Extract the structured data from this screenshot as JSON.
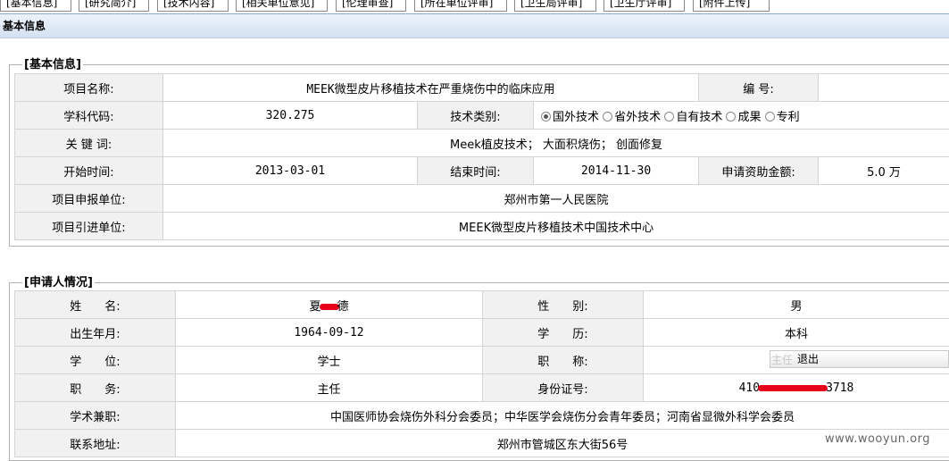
{
  "tabs": [
    {
      "label": "[基本信息]",
      "active": true
    },
    {
      "label": "[研究简介]"
    },
    {
      "label": "[技术内容]"
    },
    {
      "label": "[相关单位意见]"
    },
    {
      "label": "[伦理审查]"
    },
    {
      "label": "[所在单位评审]"
    },
    {
      "label": "[卫生局评审]"
    },
    {
      "label": "[卫生厅评审]"
    },
    {
      "label": "[附件上传]"
    }
  ],
  "section_title": "基本信息",
  "basic": {
    "legend": "[基本信息]",
    "project_name_label": "项目名称:",
    "project_name": "MEEK微型皮片移植技术在严重烧伤中的临床应用",
    "number_label": "编 号:",
    "number": "",
    "subject_code_label": "学科代码:",
    "subject_code": "320.275",
    "tech_type_label": "技术类别:",
    "tech_types": [
      {
        "label": "国外技术",
        "checked": true
      },
      {
        "label": "省外技术",
        "checked": false
      },
      {
        "label": "自有技术",
        "checked": false
      },
      {
        "label": "成果",
        "checked": false
      },
      {
        "label": "专利",
        "checked": false
      }
    ],
    "keywords_label": "关 键 词:",
    "keywords": "Meek植皮技术； 大面积烧伤； 创面修复",
    "start_label": "开始时间:",
    "start": "2013-03-01",
    "end_label": "结束时间:",
    "end": "2014-11-30",
    "funding_label": "申请资助金额:",
    "funding": "5.0 万",
    "applicant_unit_label": "项目申报单位:",
    "applicant_unit": "郑州市第一人民医院",
    "source_unit_label": "项目引进单位:",
    "source_unit": "MEEK微型皮片移植技术中国技术中心"
  },
  "applicant": {
    "legend": "[申请人情况]",
    "name_label": "姓　　名:",
    "name_first": "夏",
    "name_last": "德",
    "gender_label": "性　　别:",
    "gender": "男",
    "birth_label": "出生年月:",
    "birth": "1964-09-12",
    "education_label": "学　　历:",
    "education": "本科",
    "degree_label": "学　　位:",
    "degree": "学士",
    "title_label": "职　　称:",
    "title_partial": "主任",
    "duty_label": "职　　务:",
    "duty": "主任",
    "id_label": "身份证号:",
    "id_prefix": "410",
    "id_suffix": "3718",
    "parttime_label": "学术兼职:",
    "parttime": "中国医师协会烧伤外科分会委员；中华医学会烧伤分会青年委员；河南省显微外科学会委员",
    "address_label": "联系地址:",
    "address": "郑州市管城区东大街56号"
  },
  "popup": {
    "quit_label": "退出"
  },
  "watermark": "www.wooyun.org"
}
